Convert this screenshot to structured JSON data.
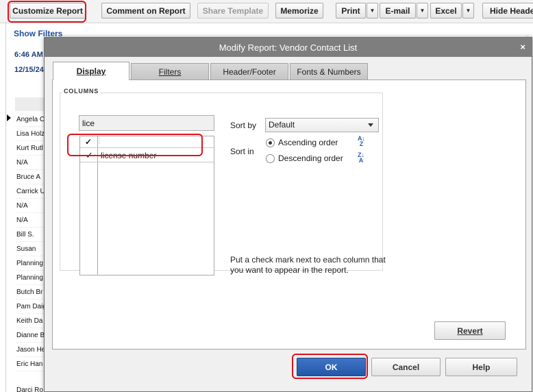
{
  "toolbar": {
    "customize_report": "Customize Report",
    "comment_on_report": "Comment on Report",
    "share_template": "Share Template",
    "memorize": "Memorize",
    "print": "Print",
    "email": "E-mail",
    "excel": "Excel",
    "hide_header": "Hide Heade"
  },
  "report": {
    "show_filters": "Show Filters",
    "time": "6:46 AM",
    "date": "12/15/24",
    "rows": [
      "Angela C",
      "Lisa Holz",
      "Kurt Rutl",
      "N/A",
      "Bruce A",
      "Carrick U",
      "N/A",
      "N/A",
      "Bill S.",
      "Susan",
      "Planning",
      "Planning",
      "Butch Br",
      "Pam Daig",
      "Keith Da",
      "Dianne B",
      "Jason He",
      "Eric Han"
    ],
    "last_row": "Darci Ro"
  },
  "dialog": {
    "title": "Modify Report: Vendor Contact List",
    "close_glyph": "×",
    "tabs": [
      {
        "label": "Display",
        "active": true
      },
      {
        "label": "Filters",
        "active": false
      },
      {
        "label": "Header/Footer",
        "active": false
      },
      {
        "label": "Fonts & Numbers",
        "active": false
      }
    ],
    "columns": {
      "legend": "COLUMNS",
      "search_value": "lice",
      "header_check": "✓",
      "header_grip": "⋮",
      "items": [
        {
          "checked": true,
          "check_glyph": "✓",
          "label": "license number"
        }
      ]
    },
    "sort": {
      "sort_by_label": "Sort by",
      "sort_by_value": "Default",
      "sort_in_label": "Sort in",
      "ascending_label": "Ascending order",
      "descending_label": "Descending order",
      "selected": "ascending",
      "ascending_icon": "sort-ascending-icon",
      "descending_icon": "sort-descending-icon",
      "ascending_icon_top": "A",
      "ascending_icon_bottom": "Z",
      "descending_icon_top": "Z",
      "descending_icon_bottom": "A"
    },
    "hint": "Put a check mark next to each column that you want to appear in the report.",
    "buttons": {
      "revert": "Revert",
      "ok": "OK",
      "cancel": "Cancel",
      "help": "Help"
    }
  },
  "colors": {
    "highlight_ring": "#e0111b",
    "ok_button": "#2f63b6",
    "link_blue": "#1e4f9e",
    "title_bar": "#7e7e7e"
  }
}
